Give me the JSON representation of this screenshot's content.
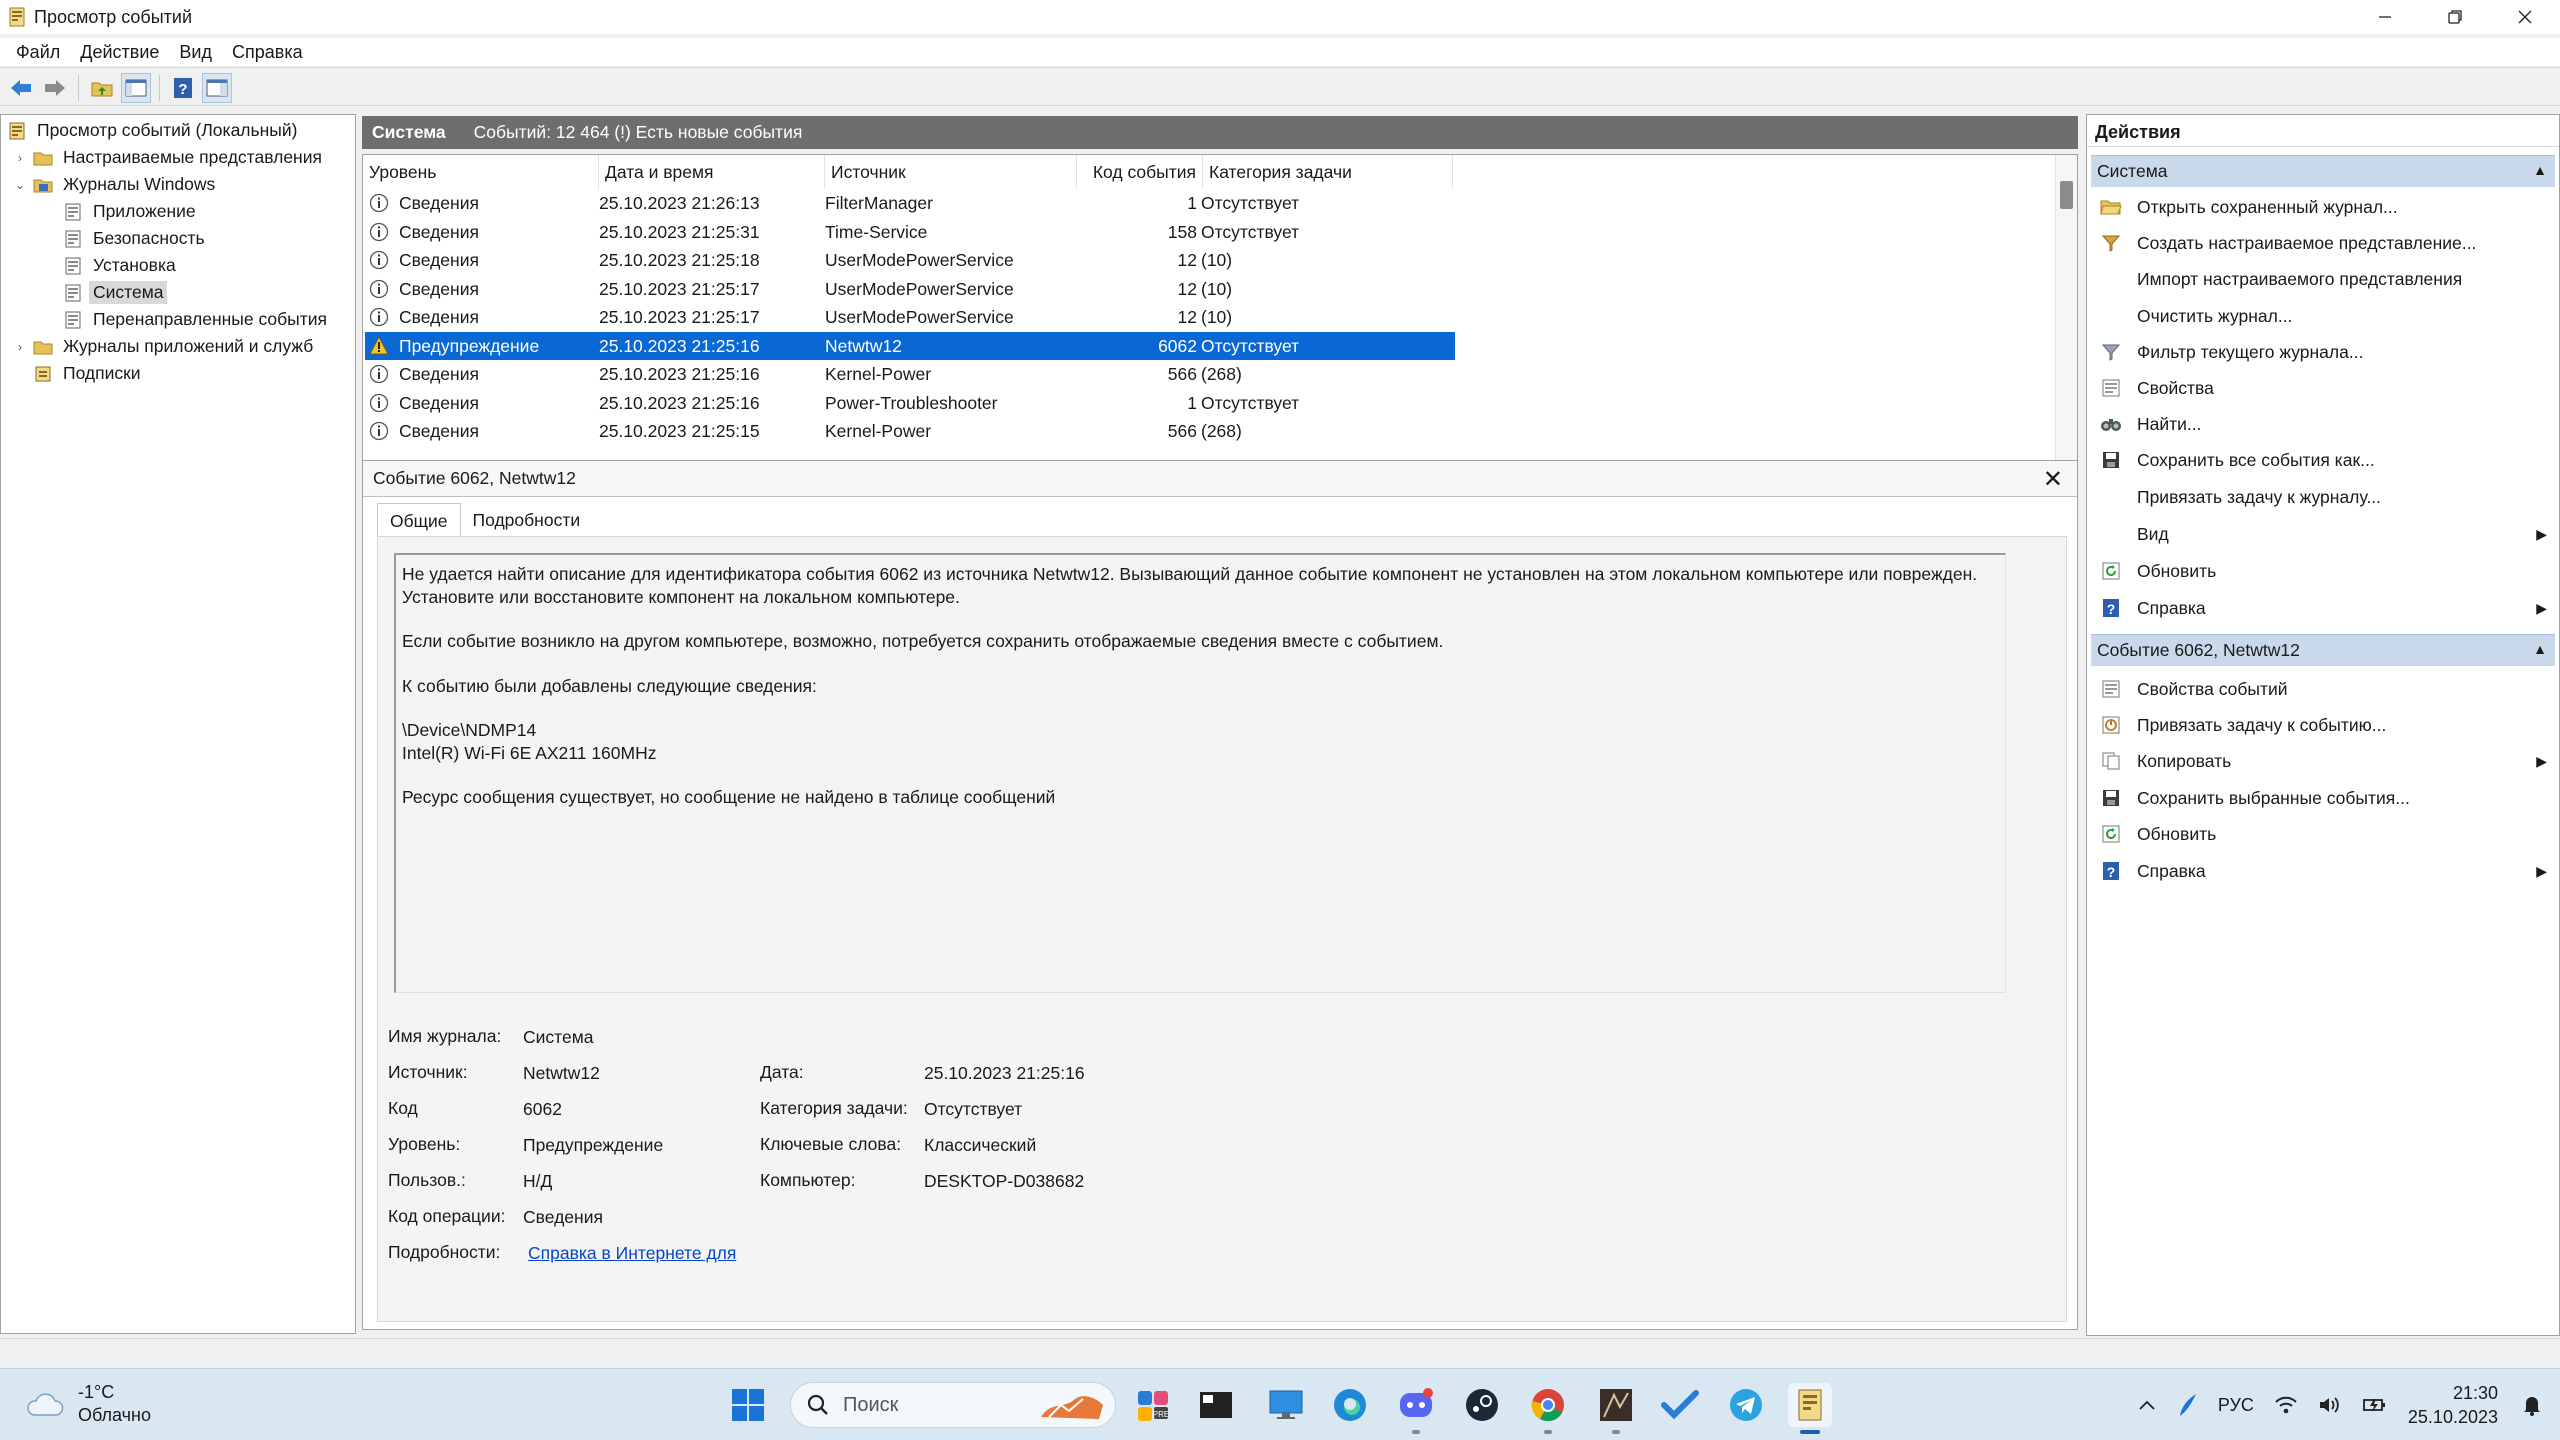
{
  "window": {
    "title": "Просмотр событий"
  },
  "menu": [
    "Файл",
    "Действие",
    "Вид",
    "Справка"
  ],
  "tree": {
    "items": [
      {
        "label": "Просмотр событий (Локальный)"
      },
      {
        "label": "Настраиваемые представления"
      },
      {
        "label": "Журналы Windows"
      },
      {
        "label": "Приложение"
      },
      {
        "label": "Безопасность"
      },
      {
        "label": "Установка"
      },
      {
        "label": "Система"
      },
      {
        "label": "Перенаправленные события"
      },
      {
        "label": "Журналы приложений и служб"
      },
      {
        "label": "Подписки"
      }
    ]
  },
  "list": {
    "title": "Система",
    "summary": "Событий: 12 464 (!) Есть новые события",
    "columns": [
      "Уровень",
      "Дата и время",
      "Источник",
      "Код события",
      "Категория задачи"
    ],
    "rows": [
      {
        "level": "Сведения",
        "datetime": "25.10.2023 21:26:13",
        "source": "FilterManager",
        "code": "1",
        "category": "Отсутствует",
        "type": "info"
      },
      {
        "level": "Сведения",
        "datetime": "25.10.2023 21:25:31",
        "source": "Time-Service",
        "code": "158",
        "category": "Отсутствует",
        "type": "info"
      },
      {
        "level": "Сведения",
        "datetime": "25.10.2023 21:25:18",
        "source": "UserModePowerService",
        "code": "12",
        "category": "(10)",
        "type": "info"
      },
      {
        "level": "Сведения",
        "datetime": "25.10.2023 21:25:17",
        "source": "UserModePowerService",
        "code": "12",
        "category": "(10)",
        "type": "info"
      },
      {
        "level": "Сведения",
        "datetime": "25.10.2023 21:25:17",
        "source": "UserModePowerService",
        "code": "12",
        "category": "(10)",
        "type": "info"
      },
      {
        "level": "Предупреждение",
        "datetime": "25.10.2023 21:25:16",
        "source": "Netwtw12",
        "code": "6062",
        "category": "Отсутствует",
        "type": "warning"
      },
      {
        "level": "Сведения",
        "datetime": "25.10.2023 21:25:16",
        "source": "Kernel-Power",
        "code": "566",
        "category": "(268)",
        "type": "info"
      },
      {
        "level": "Сведения",
        "datetime": "25.10.2023 21:25:16",
        "source": "Power-Troubleshooter",
        "code": "1",
        "category": "Отсутствует",
        "type": "info"
      },
      {
        "level": "Сведения",
        "datetime": "25.10.2023 21:25:15",
        "source": "Kernel-Power",
        "code": "566",
        "category": "(268)",
        "type": "info"
      }
    ]
  },
  "detail": {
    "title": "Событие 6062, Netwtw12",
    "tabs": [
      "Общие",
      "Подробности"
    ],
    "description": {
      "p1a": "Не удается найти описание для идентификатора события 6062 из источника Netwtw12. Вызывающий данное событие компонент не установлен на этом локальном компьютере или поврежден.",
      "p1b": "Установите или восстановите компонент на локальном компьютере.",
      "p2": "Если событие возникло на другом компьютере, возможно, потребуется сохранить отображаемые сведения вместе с событием.",
      "p3": "К событию были добавлены следующие сведения:",
      "p4a": "\\Device\\NDMP14",
      "p4b": "Intel(R) Wi-Fi 6E AX211 160MHz",
      "p5": "Ресурс сообщения существует, но сообщение не найдено в таблице сообщений"
    },
    "props": {
      "log_name_label": "Имя журнала:",
      "log_name": "Система",
      "source_label": "Источник:",
      "source": "Netwtw12",
      "date_label": "Дата:",
      "date": "25.10.2023 21:25:16",
      "code_label": "Код",
      "code": "6062",
      "task_category_label": "Категория задачи:",
      "task_category": "Отсутствует",
      "level_label": "Уровень:",
      "level": "Предупреждение",
      "keywords_label": "Ключевые слова:",
      "keywords": "Классический",
      "user_label": "Пользов.:",
      "user": "Н/Д",
      "computer_label": "Компьютер:",
      "computer": "DESKTOP-D038682",
      "opcode_label": "Код операции:",
      "opcode": "Сведения",
      "more_label": "Подробности:",
      "more_link": "Справка в Интернете для "
    }
  },
  "actions": {
    "title": "Действия",
    "group1": {
      "title": "Система",
      "items": [
        "Открыть сохраненный журнал...",
        "Создать настраиваемое представление...",
        "Импорт настраиваемого представления",
        "Очистить журнал...",
        "Фильтр текущего журнала...",
        "Свойства",
        "Найти...",
        "Сохранить все события как...",
        "Привязать задачу к журналу...",
        "Вид",
        "Обновить",
        "Справка"
      ]
    },
    "group2": {
      "title": "Событие 6062, Netwtw12",
      "items": [
        "Свойства событий",
        "Привязать задачу к событию...",
        "Копировать",
        "Сохранить выбранные события...",
        "Обновить",
        "Справка"
      ]
    }
  },
  "taskbar": {
    "weather_temp": "-1°C",
    "weather_desc": "Облачно",
    "search_placeholder": "Поиск",
    "lang": "РУС",
    "time": "21:30",
    "date": "25.10.2023"
  }
}
